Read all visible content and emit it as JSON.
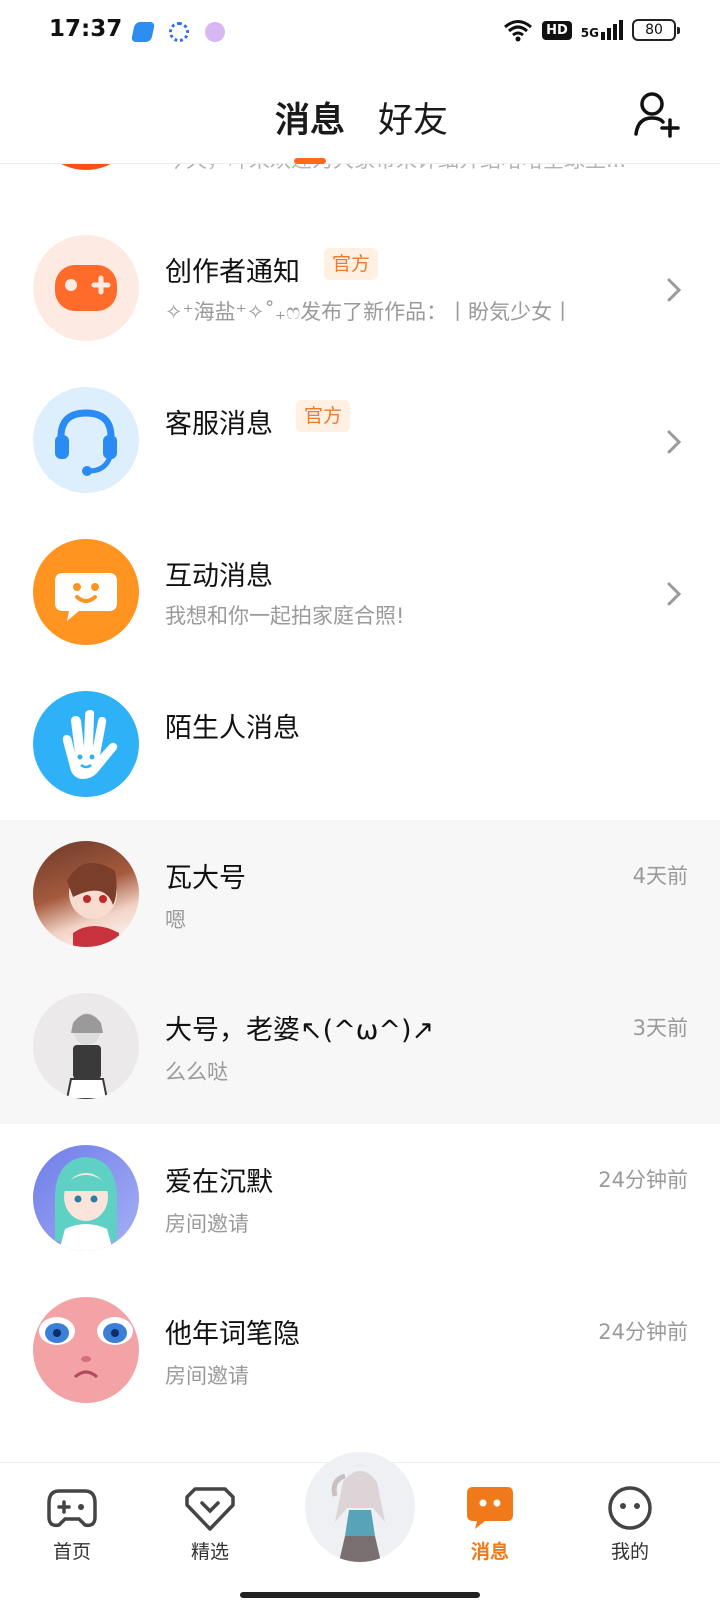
{
  "status_bar": {
    "time": "17:37",
    "hd": "HD",
    "network": "5G",
    "battery": "80"
  },
  "header": {
    "tabs": [
      {
        "label": "消息",
        "active": true
      },
      {
        "label": "好友",
        "active": false
      }
    ],
    "add_friend_icon": "add-friend-icon"
  },
  "messages": {
    "top_partial": {
      "subtitle": "今天，哗来欢迎为大家带来详细介绍哈哈全球王..."
    },
    "creator_notice": {
      "title": "创作者通知",
      "badge": "官方",
      "subtitle": "✧⁺海盐⁺✧˚₊ෆ发布了新作品：丨盼気少女丨",
      "icon": "gamepad-icon",
      "color": "#ff6b2a"
    },
    "customer_service": {
      "title": "客服消息",
      "badge": "官方",
      "icon": "headset-icon",
      "color": "#2a8bf5"
    },
    "interaction": {
      "title": "互动消息",
      "subtitle": "我想和你一起拍家庭合照!",
      "icon": "chat-face-icon",
      "color": "#ff9420"
    },
    "stranger": {
      "title": "陌生人消息",
      "icon": "waving-hand-icon",
      "color": "#2fb1f7"
    },
    "conversations": [
      {
        "name": "瓦大号",
        "preview": "嗯",
        "time": "4天前",
        "pinned": true
      },
      {
        "name": "大号，老婆↖(^ω^)↗",
        "preview": "么么哒",
        "time": "3天前",
        "pinned": true
      },
      {
        "name": "爱在沉默",
        "preview": "房间邀请",
        "time": "24分钟前",
        "pinned": false
      },
      {
        "name": "他年词笔隐",
        "preview": "房间邀请",
        "time": "24分钟前",
        "pinned": false
      }
    ]
  },
  "bottom_nav": {
    "items": [
      {
        "label": "首页",
        "icon": "gamepad-outline-icon",
        "active": false
      },
      {
        "label": "精选",
        "icon": "heart-badge-icon",
        "active": false
      },
      {
        "label": "消息",
        "icon": "message-bubble-icon",
        "active": true
      },
      {
        "label": "我的",
        "icon": "smiley-face-icon",
        "active": false
      }
    ],
    "accent": "#f07a1a"
  }
}
